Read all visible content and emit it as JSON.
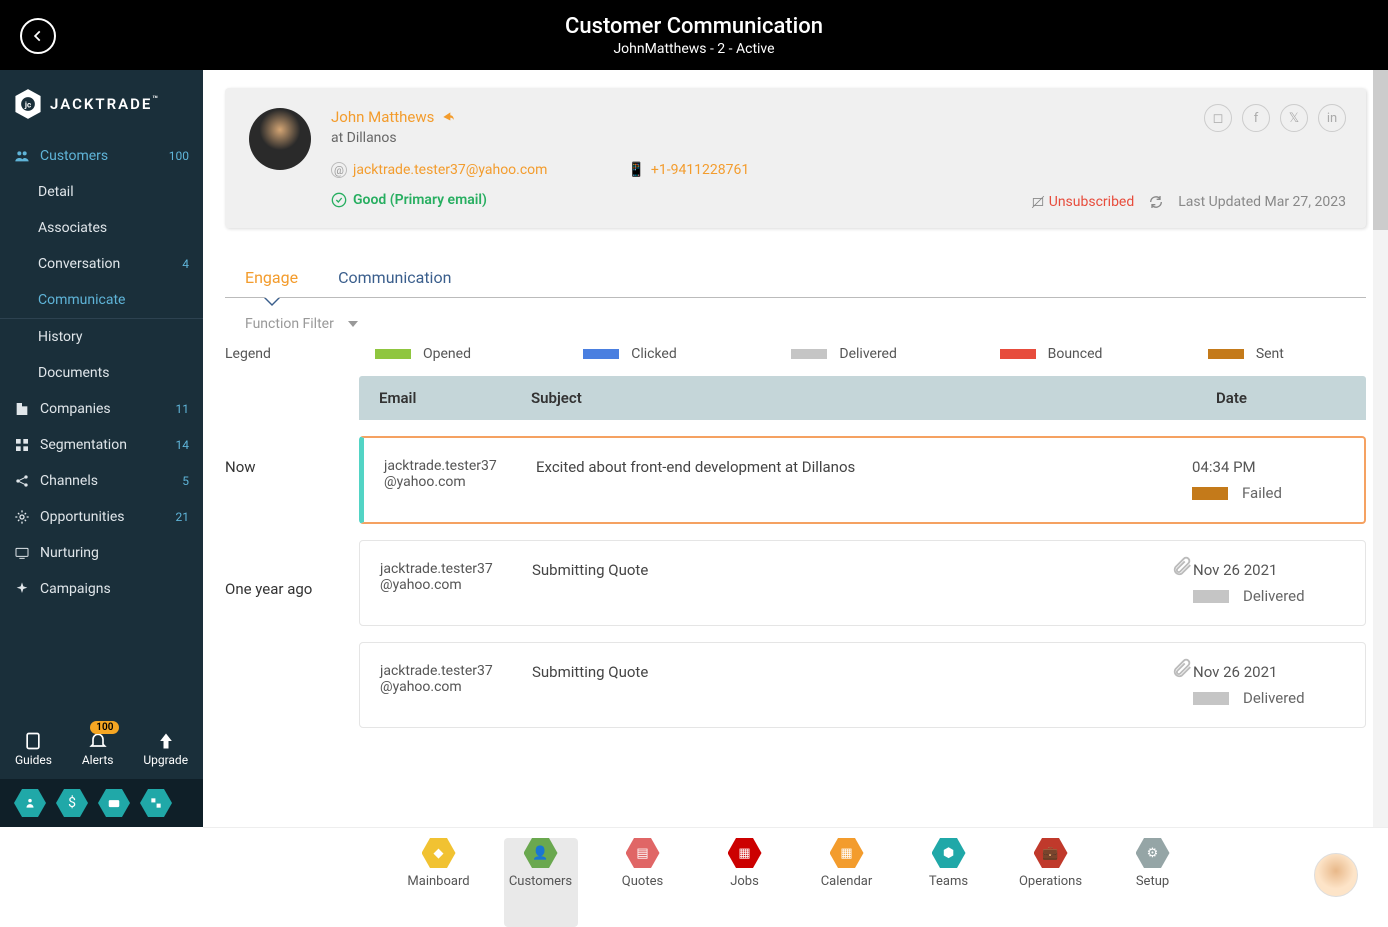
{
  "header": {
    "title": "Customer Communication",
    "subtitle": "JohnMatthews - 2 - Active"
  },
  "brand": {
    "name": "JACKTRADE",
    "tm": "™"
  },
  "sidebar": {
    "items": [
      {
        "label": "Customers",
        "badge": "100",
        "active": true,
        "icon": "users"
      },
      {
        "label": "Detail",
        "sub": true
      },
      {
        "label": "Associates",
        "sub": true
      },
      {
        "label": "Conversation",
        "sub": true,
        "badge": "4"
      },
      {
        "label": "Communicate",
        "sub": true,
        "active": true
      },
      {
        "label": "History",
        "sub": true
      },
      {
        "label": "Documents",
        "sub": true
      },
      {
        "label": "Companies",
        "badge": "11",
        "icon": "building"
      },
      {
        "label": "Segmentation",
        "badge": "14",
        "icon": "grid"
      },
      {
        "label": "Channels",
        "badge": "5",
        "icon": "share"
      },
      {
        "label": "Opportunities",
        "badge": "21",
        "icon": "gear"
      },
      {
        "label": "Nurturing",
        "icon": "screen"
      },
      {
        "label": "Campaigns",
        "icon": "sparkle"
      }
    ],
    "bottom": [
      {
        "label": "Guides",
        "icon": "device"
      },
      {
        "label": "Alerts",
        "icon": "bell",
        "badge": "100"
      },
      {
        "label": "Upgrade",
        "icon": "arrow-up"
      }
    ]
  },
  "profile": {
    "name": "John Matthews",
    "company": "at Dillanos",
    "email": "jacktrade.tester37@yahoo.com",
    "phone": "+1-9411228761",
    "status": "Good (Primary email)",
    "unsubscribed": "Unsubscribed",
    "lastUpdated": "Last Updated Mar 27, 2023"
  },
  "tabs": {
    "engage": "Engage",
    "communication": "Communication"
  },
  "filter": {
    "label": "Function Filter"
  },
  "legend": {
    "title": "Legend",
    "items": [
      {
        "label": "Opened",
        "color": "#8fc63f"
      },
      {
        "label": "Clicked",
        "color": "#4a7fe0"
      },
      {
        "label": "Delivered",
        "color": "#c5c5c5"
      },
      {
        "label": "Bounced",
        "color": "#e74c3c"
      },
      {
        "label": "Sent",
        "color": "#c47a1a"
      }
    ]
  },
  "table": {
    "headers": {
      "email": "Email",
      "subject": "Subject",
      "date": "Date"
    }
  },
  "timeGroups": [
    {
      "label": "Now"
    },
    {
      "label": "One year ago"
    }
  ],
  "emails": [
    {
      "email": "jacktrade.tester37@yahoo.com",
      "subject": "Excited about front-end development at Dillanos",
      "date": "04:34 PM",
      "status": "Failed",
      "statusColor": "#c47a1a",
      "highlighted": true,
      "attach": false
    },
    {
      "email": "jacktrade.tester37@yahoo.com",
      "subject": "Submitting Quote",
      "date": "Nov 26 2021",
      "status": "Delivered",
      "statusColor": "#c5c5c5",
      "attach": true
    },
    {
      "email": "jacktrade.tester37@yahoo.com",
      "subject": "Submitting Quote",
      "date": "Nov 26 2021",
      "status": "Delivered",
      "statusColor": "#c5c5c5",
      "attach": true
    }
  ],
  "bottomNav": [
    {
      "label": "Mainboard",
      "color": "#f1c232"
    },
    {
      "label": "Customers",
      "color": "#6aa84f",
      "active": true
    },
    {
      "label": "Quotes",
      "color": "#e06666"
    },
    {
      "label": "Jobs",
      "color": "#cc0000"
    },
    {
      "label": "Calendar",
      "color": "#f39c2d"
    },
    {
      "label": "Teams",
      "color": "#20a8a8"
    },
    {
      "label": "Operations",
      "color": "#c0392b"
    },
    {
      "label": "Setup",
      "color": "#95a5a6"
    }
  ]
}
